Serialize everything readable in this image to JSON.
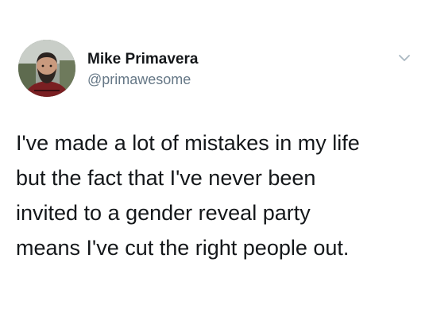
{
  "tweet": {
    "author": {
      "display_name": "Mike Primavera",
      "handle": "@primawesome",
      "avatar_icon": "user-avatar-photo"
    },
    "menu_icon": "chevron-down-icon",
    "text_lines": [
      "I've made a lot of mistakes in my life",
      "but the fact that I've never been",
      "invited to a gender reveal party",
      "means I've cut the right people out."
    ]
  },
  "colors": {
    "text": "#14171a",
    "secondary_text": "#657786",
    "chevron": "#aab8c2",
    "background": "#ffffff"
  }
}
